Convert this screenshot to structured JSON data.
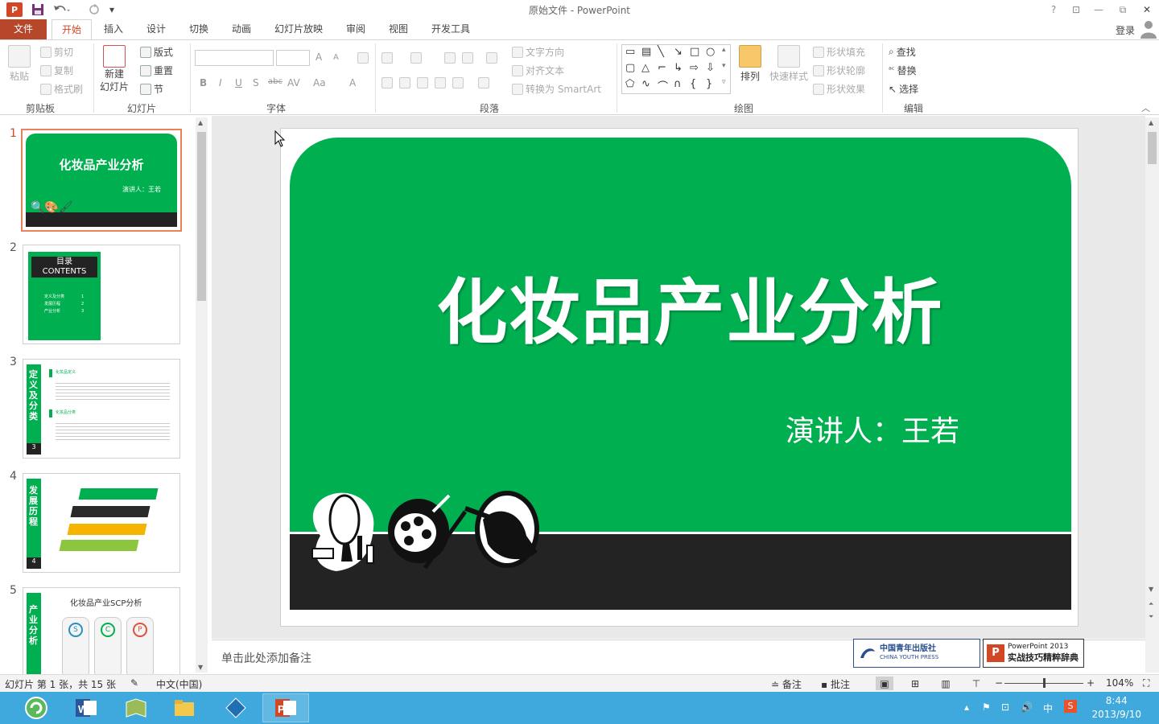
{
  "window": {
    "title": "原始文件 - PowerPoint",
    "app_icon": "P"
  },
  "quick_access": {
    "save": "save-icon",
    "undo": "undo-icon",
    "redo": "redo-icon",
    "more": "▾"
  },
  "window_controls": {
    "help": "?",
    "ribbon_opts": "⊡",
    "minimize": "—",
    "restore": "⧉",
    "close": "✕"
  },
  "tabs": [
    {
      "label": "文件"
    },
    {
      "label": "开始"
    },
    {
      "label": "插入"
    },
    {
      "label": "设计"
    },
    {
      "label": "切换"
    },
    {
      "label": "动画"
    },
    {
      "label": "幻灯片放映"
    },
    {
      "label": "审阅"
    },
    {
      "label": "视图"
    },
    {
      "label": "开发工具"
    }
  ],
  "account": {
    "login": "登录"
  },
  "ribbon": {
    "clipboard": {
      "paste": "粘贴",
      "cut": "剪切",
      "copy": "复制",
      "format_painter": "格式刷",
      "label": "剪贴板"
    },
    "slides": {
      "new_slide_1": "新建",
      "new_slide_2": "幻灯片",
      "layout": "版式",
      "reset": "重置",
      "section": "节",
      "label": "幻灯片"
    },
    "font": {
      "label": "字体",
      "bold": "B",
      "italic": "I",
      "underline": "U",
      "shadow": "S",
      "strike": "abc",
      "spacing": "AV",
      "case": "Aa",
      "grow": "A",
      "shrink": "A",
      "color": "A"
    },
    "paragraph": {
      "label": "段落",
      "text_dir": "文字方向",
      "align_text": "对齐文本",
      "smartart": "转换为 SmartArt"
    },
    "drawing": {
      "label": "绘图",
      "arrange": "排列",
      "quick_styles": "快速样式",
      "fill": "形状填充",
      "outline": "形状轮廓",
      "effects": "形状效果"
    },
    "editing": {
      "label": "编辑",
      "find": "查找",
      "replace": "替换",
      "select": "选择"
    }
  },
  "thumbnails": [
    {
      "num": "1",
      "title": "化妆品产业分析",
      "subtitle": "演讲人：王若"
    },
    {
      "num": "2",
      "title_cn": "目录",
      "title_en": "CONTENTS",
      "items": [
        "定义及分类",
        "发展历程",
        "产业分析"
      ],
      "item_nums": [
        "1",
        "2",
        "3"
      ]
    },
    {
      "num": "3",
      "side": "定义及分类",
      "page": "3",
      "h1": "化妆品定义",
      "h2": "化妆品分类"
    },
    {
      "num": "4",
      "side": "发展历程",
      "page": "4"
    },
    {
      "num": "5",
      "side": "产业分析",
      "title": "化妆品产业SCP分析",
      "circles": [
        "S",
        "C",
        "P"
      ]
    }
  ],
  "slide": {
    "title": "化妆品产业分析",
    "speaker": "演讲人：王若",
    "colors": {
      "green": "#00b050",
      "dark": "#232323"
    }
  },
  "notes": {
    "placeholder": "单击此处添加备注"
  },
  "branding": {
    "publisher_cn": "中国青年出版社",
    "publisher_en": "CHINA YOUTH PRESS",
    "book_line1": "PowerPoint 2013",
    "book_line2": "实战技巧精粹辞典"
  },
  "status": {
    "slide_info": "幻灯片 第 1 张，共 15 张",
    "language": "中文(中国)",
    "notes_btn": "备注",
    "comments_btn": "批注",
    "zoom": "104%"
  },
  "taskbar": {
    "apps": [
      "browser-icon",
      "word-icon",
      "book-icon",
      "explorer-icon",
      "media-icon",
      "powerpoint-icon"
    ],
    "ime": "中",
    "time": "8:44",
    "date": "2013/9/10"
  }
}
